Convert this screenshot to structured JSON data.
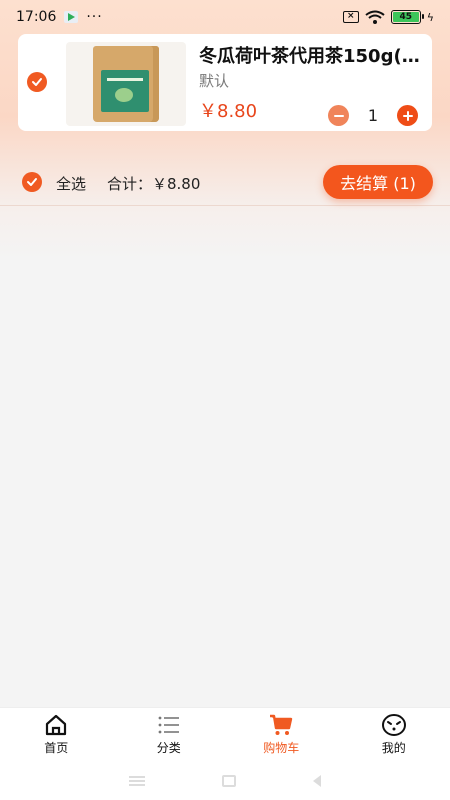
{
  "status_bar": {
    "time": "17:06",
    "dots": "···",
    "battery_level": "45",
    "icons": [
      "play-store-icon",
      "sim-x-icon",
      "wifi-icon",
      "battery-icon",
      "charging-bolt-icon"
    ]
  },
  "cart": {
    "items": [
      {
        "name": "冬瓜荷叶茶代用茶150g(5...",
        "spec": "默认",
        "price": "￥8.80",
        "quantity": "1",
        "checked": true
      }
    ]
  },
  "summary": {
    "select_all_label": "全选",
    "total_text": "合计：￥8.80",
    "checkout_label": "去结算 (1)"
  },
  "tabbar": {
    "tabs": [
      {
        "label": "首页",
        "icon": "home-icon",
        "active": false
      },
      {
        "label": "分类",
        "icon": "list-icon",
        "active": false
      },
      {
        "label": "购物车",
        "icon": "cart-icon",
        "active": true
      },
      {
        "label": "我的",
        "icon": "face-icon",
        "active": false
      }
    ]
  },
  "colors": {
    "accent": "#f05a22",
    "price": "#e8461c",
    "header_gradient_top": "#fde0cf"
  }
}
